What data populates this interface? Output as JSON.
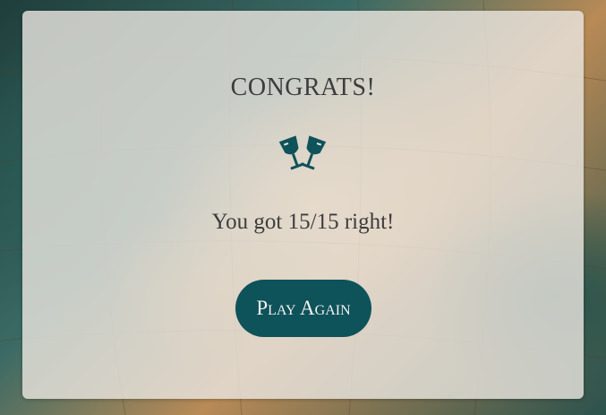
{
  "modal": {
    "title": "CONGRATS!",
    "icon": "glasses-cheers-icon",
    "score_text": "You got 15/15 right!",
    "play_again_label": "Play Again"
  },
  "colors": {
    "button_bg": "#0e525a",
    "icon_color": "#0e525a",
    "text_color": "#3d3d3d",
    "card_bg": "rgba(232,228,222,0.82)"
  }
}
